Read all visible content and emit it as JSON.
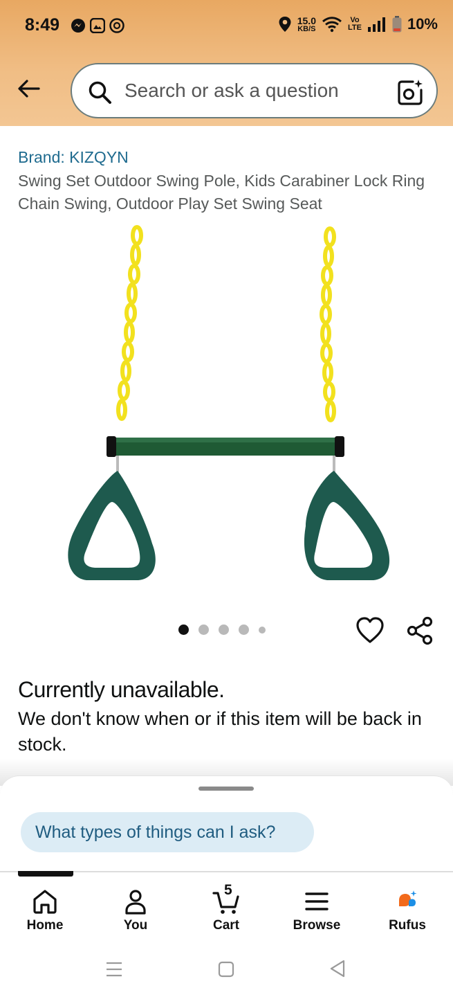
{
  "status_bar": {
    "time": "8:49",
    "net_speed_value": "15.0",
    "net_speed_unit": "KB/S",
    "volte_top": "Vo",
    "volte_bottom": "LTE",
    "battery": "10%",
    "icons_left": [
      "messenger-icon",
      "gallery-icon",
      "threads-icon"
    ],
    "icons_right": [
      "location-icon",
      "wifi-icon",
      "signal-icon",
      "battery-icon"
    ]
  },
  "search": {
    "placeholder": "Search or ask a question"
  },
  "product": {
    "brand": "Brand: KIZQYN",
    "title": "Swing Set Outdoor Swing Pole, Kids Carabiner Lock Ring Chain Swing, Outdoor Play Set Swing Seat",
    "image_count": 5,
    "active_image": 1
  },
  "availability": {
    "status": "Currently unavailable.",
    "message": "We don't know when or if this item will be back in stock."
  },
  "rufus_sheet": {
    "chip": "What types of things can I ask?"
  },
  "bottom_nav": {
    "items": [
      {
        "label": "Home",
        "icon": "home-icon"
      },
      {
        "label": "You",
        "icon": "person-icon"
      },
      {
        "label": "Cart",
        "icon": "cart-icon",
        "badge": "5"
      },
      {
        "label": "Browse",
        "icon": "menu-icon"
      },
      {
        "label": "Rufus",
        "icon": "rufus-icon"
      }
    ],
    "active": "Home"
  },
  "colors": {
    "header_top": "#e8a862",
    "header_bottom": "#f3c693",
    "link": "#1f6b8f",
    "chip_bg": "#dcecf5",
    "chip_text": "#1f5c80",
    "chain_yellow": "#f2e11e",
    "bar_green": "#1f5a34",
    "handle_teal": "#1e5a4e"
  }
}
